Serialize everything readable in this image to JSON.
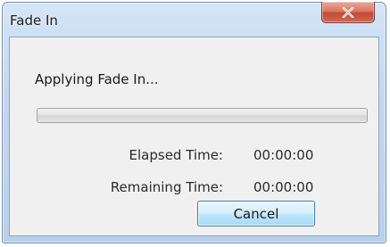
{
  "window": {
    "title": "Fade In",
    "close_icon": "close-icon"
  },
  "dialog": {
    "status_text": "Applying Fade In...",
    "progress_fraction": 0,
    "elapsed_label": "Elapsed Time:",
    "elapsed_value": "00:00:00",
    "remaining_label": "Remaining Time:",
    "remaining_value": "00:00:00",
    "cancel_label": "Cancel"
  },
  "colors": {
    "close_button": "#c24a36",
    "progress_track": "#e3e3e3",
    "cancel_border": "#3c7fb1"
  }
}
